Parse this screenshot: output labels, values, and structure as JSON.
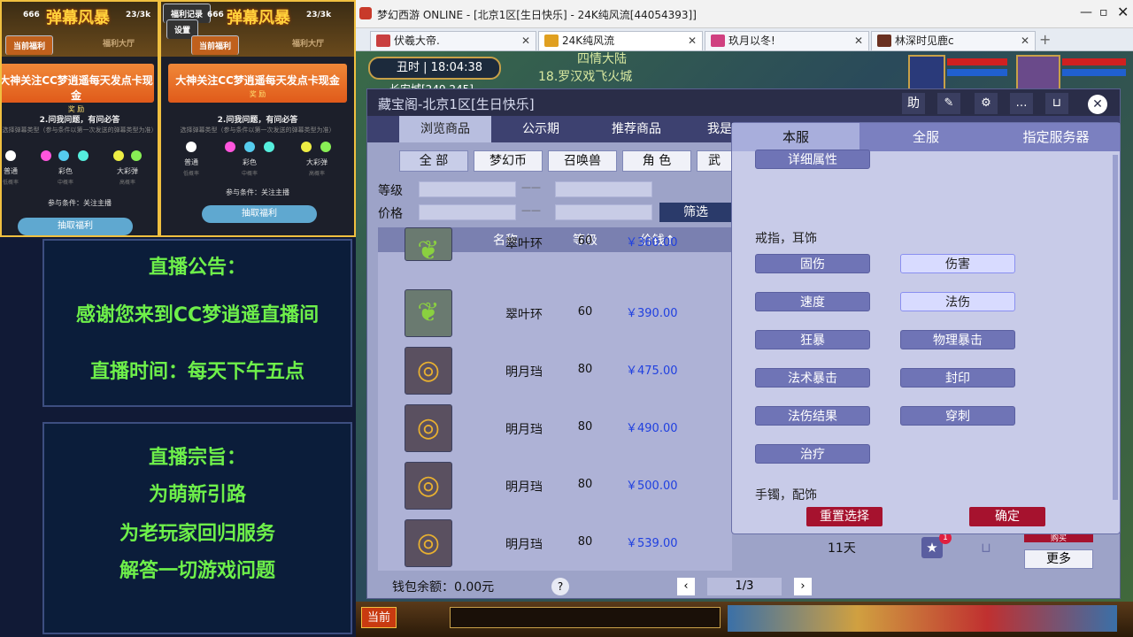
{
  "promo_cards": [
    {
      "l666": "666",
      "logo": "弹幕风暴",
      "r23": "23/3k",
      "tab_active": "当前福利",
      "tab_inactive": "福利大厅",
      "banner": "大神关注CC梦逍遥每天发点卡现金",
      "banner_sub": "奖 励",
      "question": "2.问我问题，有问必答",
      "sub": "选择弹幕类型（参与条件以第一次发送的弹幕类型为准）",
      "opts": [
        {
          "label": "普通",
          "hint": "低概率"
        },
        {
          "label": "彩色",
          "hint": "中概率"
        },
        {
          "label": "大彩弹",
          "hint": "高概率"
        }
      ],
      "cond": "参与条件：关注主播",
      "btn": "抽取福利"
    },
    {
      "l666": "666",
      "logo": "弹幕风暴",
      "r23": "23/3k",
      "btn_top1": "福利记录",
      "btn_top2": "设置",
      "tab_active": "当前福利",
      "tab_inactive": "福利大厅",
      "banner": "大神关注CC梦逍遥每天发点卡现金",
      "banner_sub": "奖 励",
      "question": "2.问我问题，有问必答",
      "sub": "选择弹幕类型（参与条件以第一次发送的弹幕类型为准）",
      "opts": [
        {
          "label": "普通",
          "hint": "低概率"
        },
        {
          "label": "彩色",
          "hint": "中概率"
        },
        {
          "label": "大彩弹",
          "hint": "高概率"
        }
      ],
      "cond": "参与条件：关注主播",
      "btn": "抽取福利"
    }
  ],
  "announce": {
    "title": "直播公告：",
    "line1": "感谢您来到CC梦逍遥直播间",
    "line2": "直播时间：每天下午五点"
  },
  "purpose": {
    "title": "直播宗旨：",
    "line1": "为萌新引路",
    "line2": "为老玩家回归服务",
    "line3": "解答一切游戏问题"
  },
  "window": {
    "title": "梦幻西游 ONLINE - [北京1区[生日快乐] - 24K纯风流[44054393]]"
  },
  "tabs": [
    {
      "label": "伏羲大帝."
    },
    {
      "label": "24K纯风流"
    },
    {
      "label": "玖月以冬!"
    },
    {
      "label": "林深时见鹿c"
    }
  ],
  "hud": {
    "time_label": "丑时",
    "time": "18:04:38",
    "map1": "四情大陆",
    "map2": "18.罗汉戏飞火城",
    "map3": "长安城[249,245]"
  },
  "cbg": {
    "title": "藏宝阁-北京1区[生日快乐]",
    "tabs": [
      "浏览商品",
      "公示期",
      "推荐商品",
      "我是"
    ],
    "top_icons": [
      "助",
      "笔",
      "设",
      "聊",
      "购"
    ],
    "filters": [
      "全 部",
      "梦幻币",
      "召唤兽",
      "角 色",
      "武"
    ],
    "level_label": "等级",
    "price_label": "价格",
    "dash": "——",
    "search": "筛选",
    "cols": [
      "名称",
      "等级",
      "价钱↑"
    ],
    "rows": [
      {
        "name": "翠叶环",
        "level": "60",
        "price": "￥360.00",
        "icon": "leaf-icon"
      },
      {
        "name": "翠叶环",
        "level": "60",
        "price": "￥390.00",
        "icon": "leaf-icon"
      },
      {
        "name": "明月珰",
        "level": "80",
        "price": "￥475.00",
        "icon": "pearl-ring-icon"
      },
      {
        "name": "明月珰",
        "level": "80",
        "price": "￥490.00",
        "icon": "pearl-ring-icon"
      },
      {
        "name": "明月珰",
        "level": "80",
        "price": "￥500.00",
        "icon": "pearl-ring-icon"
      },
      {
        "name": "明月珰",
        "level": "80",
        "price": "￥539.00",
        "icon": "pearl-ring-icon"
      }
    ],
    "extra": {
      "days": "11天",
      "fav_count": "1",
      "more": "更多",
      "buy": "购买"
    },
    "wallet": "钱包余额：0.00元",
    "help": "?",
    "page": "1/3"
  },
  "dropdown": {
    "tabs": [
      "本服",
      "全服",
      "指定服务器"
    ],
    "detail": "详细属性",
    "section1": "戒指，耳饰",
    "options": [
      [
        "固伤",
        "伤害"
      ],
      [
        "速度",
        "法伤"
      ],
      [
        "狂暴",
        "物理暴击"
      ],
      [
        "法术暴击",
        "封印"
      ],
      [
        "法伤结果",
        "穿刺"
      ],
      [
        "治疗",
        ""
      ]
    ],
    "selected": [
      "伤害",
      "法伤"
    ],
    "section2": "手镯，配饰",
    "reset": "重置选择",
    "ok": "确定"
  },
  "bottom": {
    "current": "当前"
  }
}
